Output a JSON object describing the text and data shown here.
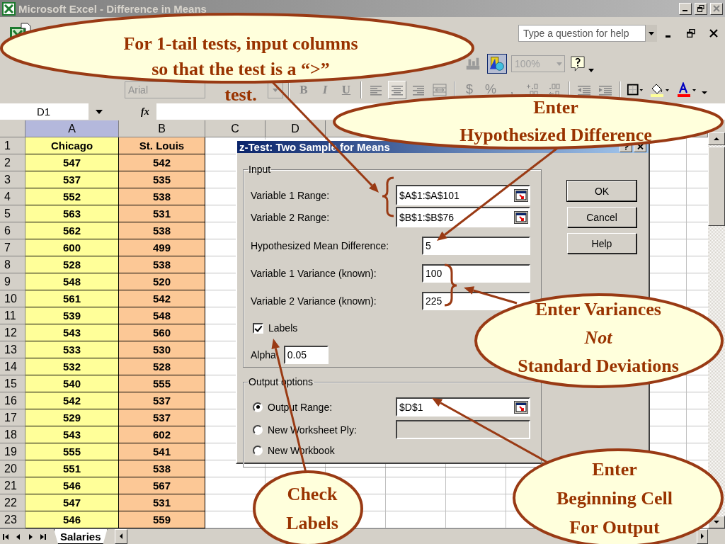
{
  "window": {
    "title": "Microsoft Excel - Difference in Means"
  },
  "help_box": {
    "placeholder": "Type a question for help"
  },
  "standard_toolbar": {
    "buttons": [
      {
        "kind": "chart",
        "selected": false
      },
      {
        "kind": "drawing",
        "selected": true
      },
      {
        "kind": "zoom",
        "value": "100%"
      },
      {
        "kind": "help",
        "selected": false
      }
    ]
  },
  "format_toolbar": {
    "font": "Arial",
    "buttons": [
      {
        "kind": "bold",
        "label": "B",
        "selected": false
      },
      {
        "kind": "italic",
        "label": "I",
        "selected": false
      },
      {
        "kind": "underline",
        "label": "U",
        "selected": false
      },
      {
        "kind": "align-left",
        "selected": false
      },
      {
        "kind": "align-center",
        "selected": true
      },
      {
        "kind": "align-right",
        "selected": false
      },
      {
        "kind": "merge",
        "selected": false
      },
      {
        "kind": "currency",
        "label": "$",
        "selected": false
      },
      {
        "kind": "percent",
        "label": "%",
        "selected": false
      },
      {
        "kind": "comma",
        "label": ",",
        "selected": false
      },
      {
        "kind": "increase-decimal",
        "selected": false
      },
      {
        "kind": "decrease-decimal",
        "selected": false
      },
      {
        "kind": "decrease-indent",
        "selected": false
      },
      {
        "kind": "increase-indent",
        "selected": false
      },
      {
        "kind": "borders",
        "selected": false
      },
      {
        "kind": "fill-color",
        "color": "#ffff99",
        "selected": false
      },
      {
        "kind": "font-color",
        "color": "#ff0000",
        "selected": false
      }
    ]
  },
  "formula_bar": {
    "cell_ref": "D1",
    "fx": "fx"
  },
  "sheet": {
    "columns": [
      {
        "label": "A",
        "selected": true
      },
      {
        "label": "B",
        "selected": false
      },
      {
        "label": "C",
        "selected": false
      },
      {
        "label": "D",
        "selected": false
      }
    ],
    "rows": [
      {
        "label": "1",
        "cells": [
          "Chicago",
          "St. Louis"
        ]
      },
      {
        "label": "2",
        "cells": [
          "547",
          "542"
        ]
      },
      {
        "label": "3",
        "cells": [
          "537",
          "535"
        ]
      },
      {
        "label": "4",
        "cells": [
          "552",
          "538"
        ]
      },
      {
        "label": "5",
        "cells": [
          "563",
          "531"
        ]
      },
      {
        "label": "6",
        "cells": [
          "562",
          "538"
        ]
      },
      {
        "label": "7",
        "cells": [
          "600",
          "499"
        ]
      },
      {
        "label": "8",
        "cells": [
          "528",
          "538"
        ]
      },
      {
        "label": "9",
        "cells": [
          "548",
          "520"
        ]
      },
      {
        "label": "10",
        "cells": [
          "561",
          "542"
        ]
      },
      {
        "label": "11",
        "cells": [
          "539",
          "548"
        ]
      },
      {
        "label": "12",
        "cells": [
          "543",
          "560"
        ]
      },
      {
        "label": "13",
        "cells": [
          "533",
          "530"
        ]
      },
      {
        "label": "14",
        "cells": [
          "532",
          "528"
        ]
      },
      {
        "label": "15",
        "cells": [
          "540",
          "555"
        ]
      },
      {
        "label": "16",
        "cells": [
          "542",
          "537"
        ]
      },
      {
        "label": "17",
        "cells": [
          "529",
          "537"
        ]
      },
      {
        "label": "18",
        "cells": [
          "543",
          "602"
        ]
      },
      {
        "label": "19",
        "cells": [
          "555",
          "541"
        ]
      },
      {
        "label": "20",
        "cells": [
          "551",
          "538"
        ]
      },
      {
        "label": "21",
        "cells": [
          "546",
          "567"
        ]
      },
      {
        "label": "22",
        "cells": [
          "547",
          "531"
        ]
      },
      {
        "label": "23",
        "cells": [
          "546",
          "559"
        ]
      }
    ]
  },
  "sheet_tabs": [
    {
      "label": "Salaries",
      "selected": true
    }
  ],
  "dialog": {
    "title": "z-Test: Two Sample for Means",
    "input": {
      "legend": "Input",
      "rows": [
        {
          "kind": "range",
          "label": "Variable 1 Range:",
          "value": "$A$1:$A$101"
        },
        {
          "kind": "range",
          "label": "Variable 2 Range:",
          "value": "$B$1:$B$76"
        },
        {
          "kind": "text",
          "label": "Hypothesized Mean Difference:",
          "value": "5"
        },
        {
          "kind": "text",
          "label": "Variable 1 Variance (known):",
          "value": "100"
        },
        {
          "kind": "text",
          "label": "Variable 2 Variance (known):",
          "value": "225"
        },
        {
          "kind": "checkbox",
          "label": "Labels",
          "checked": true
        },
        {
          "kind": "short",
          "label": "Alpha:",
          "value": "0.05"
        }
      ]
    },
    "output": {
      "legend": "Output options",
      "options": [
        {
          "kind": "range",
          "label": "Output Range:",
          "value": "$D$1",
          "selected": true
        },
        {
          "kind": "blank",
          "label": "New Worksheet Ply:",
          "selected": false
        },
        {
          "kind": "plain",
          "label": "New Workbook",
          "selected": false
        }
      ]
    },
    "buttons": [
      "OK",
      "Cancel",
      "Help"
    ]
  },
  "callouts": [
    {
      "lines": [
        "For 1-tail tests, input columns",
        "so that the test is a “>”",
        "test."
      ]
    },
    {
      "lines": [
        "Enter",
        "Hypothesized Difference"
      ]
    },
    {
      "lines": [
        "Enter Variances",
        "*Not*",
        "Standard Deviations"
      ]
    },
    {
      "lines": [
        "Check",
        "Labels"
      ]
    },
    {
      "lines": [
        "Enter",
        "Beginning Cell",
        "For Output"
      ]
    }
  ]
}
